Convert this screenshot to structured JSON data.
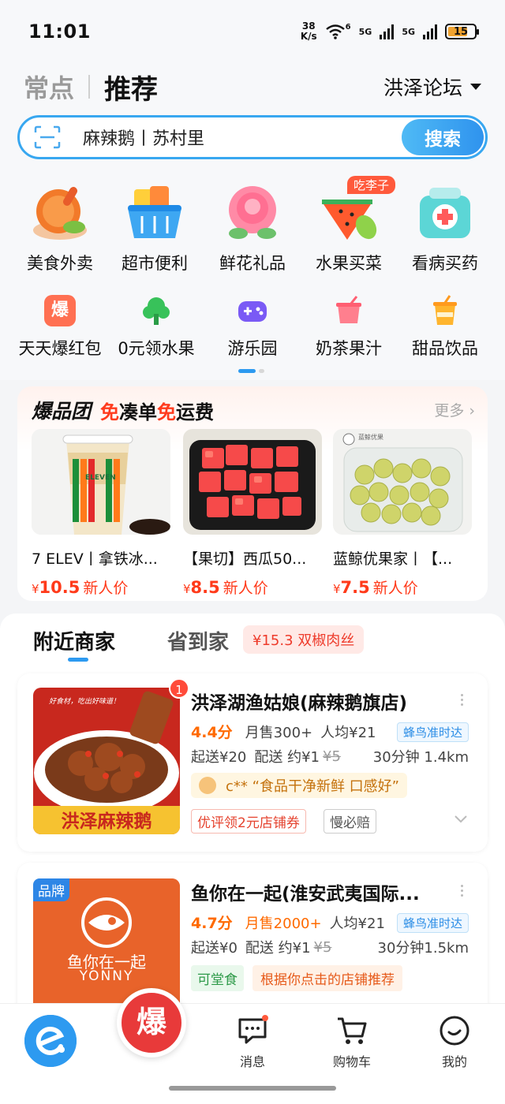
{
  "status_bar": {
    "time": "11:01",
    "net_speed_value": "38",
    "net_speed_unit": "K/s",
    "wifi_label": "6",
    "sim1_label": "5G",
    "sim2_label": "5G",
    "battery": "15"
  },
  "header": {
    "tab_inactive": "常点",
    "tab_active": "推荐",
    "location": "洪泽论坛"
  },
  "search": {
    "text": "麻辣鹅丨苏村里",
    "button": "搜索"
  },
  "categories_row1": [
    {
      "label": "美食外卖",
      "icon": "food-icon"
    },
    {
      "label": "超市便利",
      "icon": "basket-icon"
    },
    {
      "label": "鲜花礼品",
      "icon": "rose-icon"
    },
    {
      "label": "水果买菜",
      "icon": "watermelon-icon",
      "badge": "吃李子"
    },
    {
      "label": "看病买药",
      "icon": "medicine-icon"
    }
  ],
  "categories_row2": [
    {
      "label": "天天爆红包",
      "icon": "red-packet-icon",
      "glyph": "爆"
    },
    {
      "label": "0元领水果",
      "icon": "tree-icon"
    },
    {
      "label": "游乐园",
      "icon": "gamepad-icon"
    },
    {
      "label": "奶茶果汁",
      "icon": "drink-icon"
    },
    {
      "label": "甜品饮品",
      "icon": "dessert-cup-icon"
    }
  ],
  "explode_group": {
    "brand": "爆品团",
    "title_parts": [
      "免",
      "凑单 ",
      "免",
      "运费"
    ],
    "more": "更多 ›",
    "products": [
      {
        "name": "7 ELEV丨拿铁冰...",
        "currency": "¥",
        "price": "10.5",
        "tag": "新人价"
      },
      {
        "name": "【果切】西瓜50...",
        "currency": "¥",
        "price": "8.5",
        "tag": "新人价"
      },
      {
        "name": "蓝鲸优果家丨【...",
        "currency": "¥",
        "price": "7.5",
        "tag": "新人价"
      }
    ],
    "product3_img_caption": "蓝鲸优果"
  },
  "nearby": {
    "tab_active": "附近商家",
    "tab2": "省到家",
    "pill": "¥15.3 双椒肉丝",
    "shops": [
      {
        "name": "洪泽湖渔姑娘(麻辣鹅旗店)",
        "badge": "1",
        "score": "4.4分",
        "sales": "月售300+",
        "avg": "人均¥21",
        "delivery_tag": "蜂鸟准时达",
        "min": "起送¥20",
        "fee": "配送 约¥1",
        "fee_old": "¥5",
        "time_dist": "30分钟 1.4km",
        "review": "c** “食品干净新鲜 口感好”",
        "tags": [
          "优评领2元店铺券",
          "慢必赔"
        ],
        "img_caption": "洪泽麻辣鹅",
        "img_small": "好食材，吃出好味道！"
      },
      {
        "name": "鱼你在一起(淮安武夷国际...",
        "brand_badge": "品牌",
        "score": "4.7分",
        "sales": "月售2000+",
        "avg": "人均¥21",
        "delivery_tag": "蜂鸟准时达",
        "min": "起送¥0",
        "fee": "配送 约¥1",
        "fee_old": "¥5",
        "time_dist": "30分钟1.5km",
        "tags": [
          "可堂食",
          "根据你点击的店铺推荐"
        ],
        "img_title": "鱼你在一起",
        "img_sub": "YONNY"
      }
    ]
  },
  "bottom_nav": {
    "baopin": "爆",
    "messages": "消息",
    "cart": "购物车",
    "mine": "我的"
  },
  "colors": {
    "accent": "#2d9af0",
    "price_red": "#ff3a1a",
    "score_orange": "#ff6a00"
  }
}
